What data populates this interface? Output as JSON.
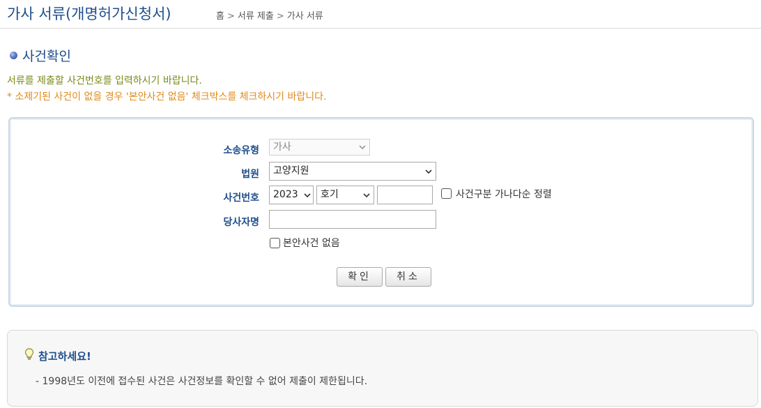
{
  "header": {
    "title": "가사 서류(개명허가신청서)",
    "breadcrumb": [
      "홈",
      "서류 제출",
      "가사 서류"
    ],
    "breadcrumb_sep": ">"
  },
  "section": {
    "title": "사건확인",
    "info_line1": "서류를 제출할 사건번호를 입력하시기 바랍니다.",
    "info_line2": "* 소제기된 사건이 없을 경우 '본안사건 없음' 체크박스를 체크하시기 바랍니다."
  },
  "form": {
    "case_type": {
      "label": "소송유형",
      "value": "가사",
      "disabled": true
    },
    "court": {
      "label": "법원",
      "value": "고양지원"
    },
    "case_number": {
      "label": "사건번호",
      "year": "2023",
      "code": "호기",
      "number": "",
      "sort_checkbox_label": "사건구분 가나다순 정렬",
      "sort_checked": false
    },
    "party_name": {
      "label": "당사자명",
      "value": ""
    },
    "no_case_checkbox": {
      "label": "본안사건 없음",
      "checked": false
    },
    "buttons": {
      "confirm": "확인",
      "cancel": "취소"
    }
  },
  "note": {
    "title": "참고하세요!",
    "text": "- 1998년도 이전에 접수된 사건은 사건정보를 확인할 수 없어 제출이 제한됩니다."
  },
  "colors": {
    "title_blue": "#1f4e8c",
    "info_olive": "#7a8a1a",
    "info_orange": "#e08a1a"
  }
}
